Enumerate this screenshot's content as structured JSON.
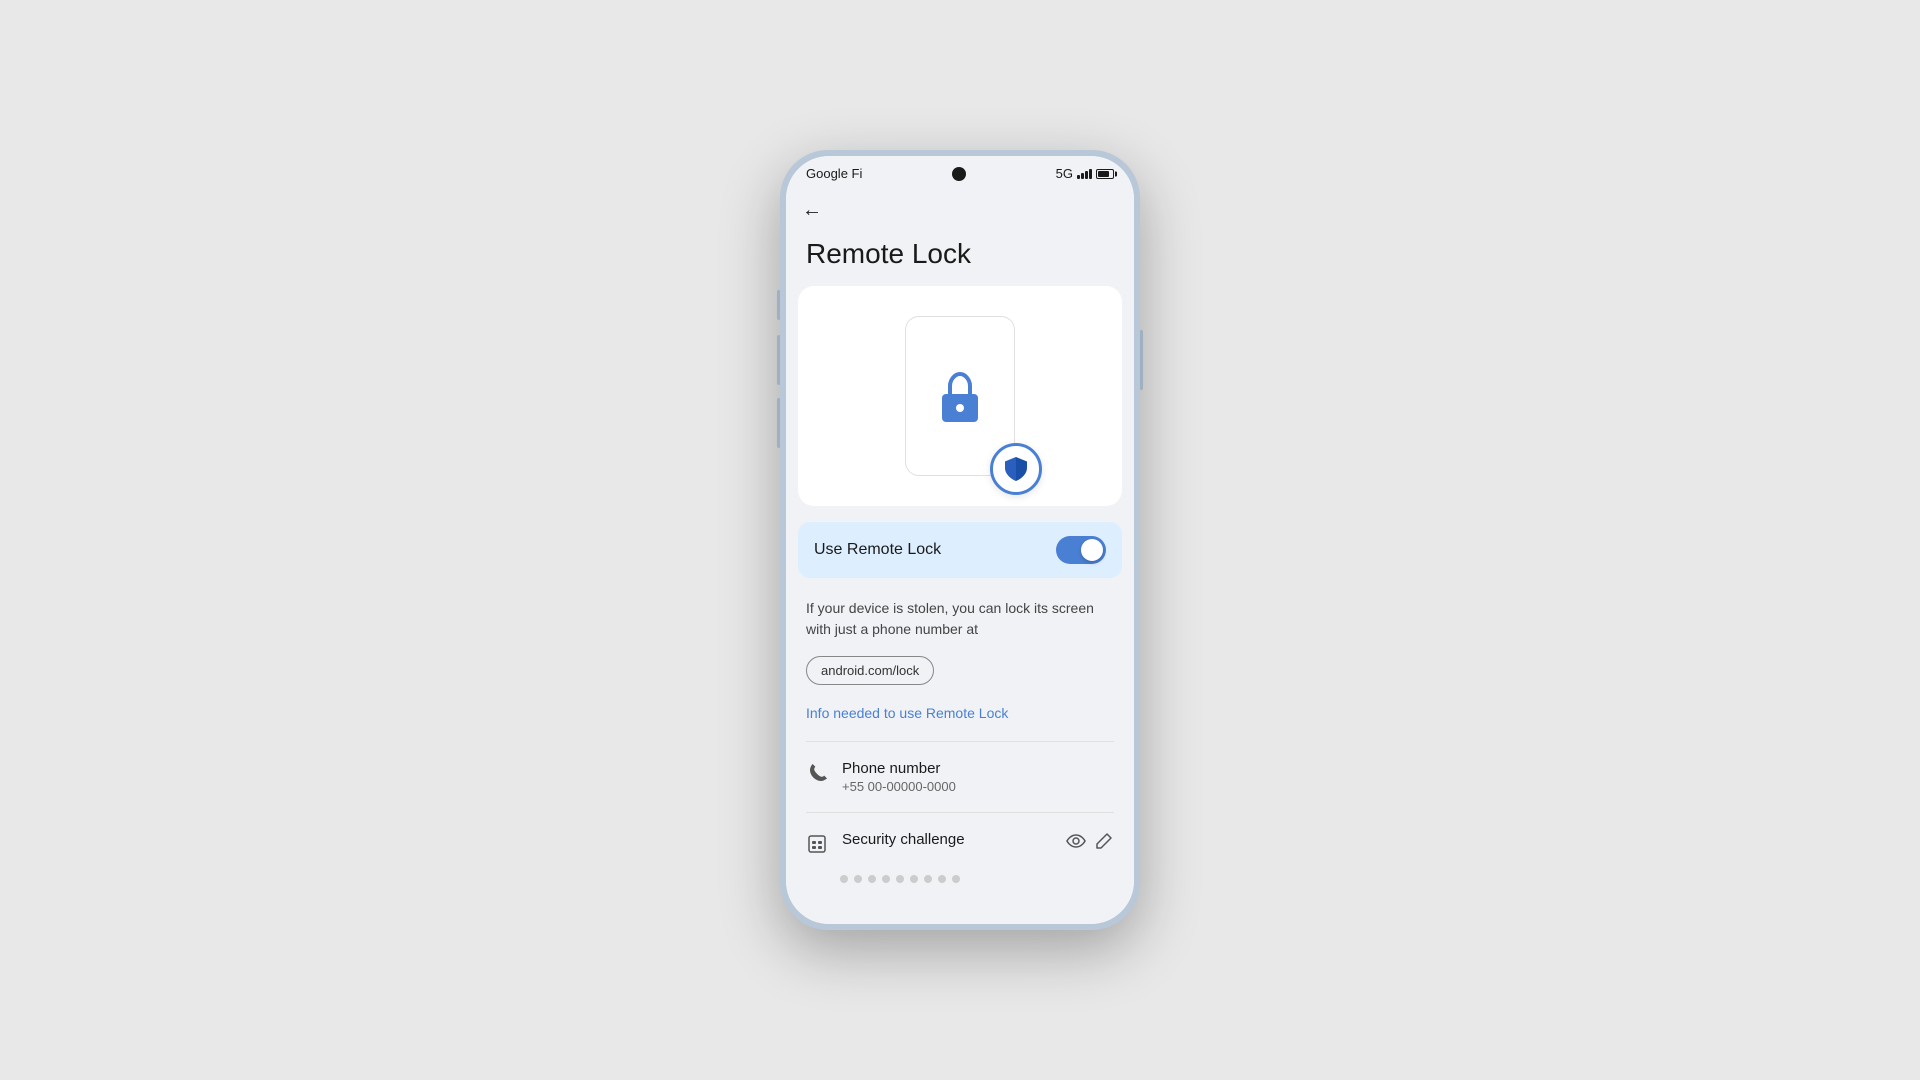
{
  "status_bar": {
    "carrier": "Google Fi",
    "network": "5G",
    "time": ""
  },
  "page": {
    "title": "Remote Lock",
    "back_label": "←"
  },
  "toggle_section": {
    "label": "Use Remote Lock",
    "enabled": true
  },
  "description": {
    "text": "If your device is stolen, you can lock its screen with just a phone number at"
  },
  "link": {
    "label": "android.com/lock"
  },
  "info_link": {
    "label": "Info needed to use Remote Lock"
  },
  "phone_number": {
    "title": "Phone number",
    "value": "+55 00-00000-0000"
  },
  "security_challenge": {
    "title": "Security challenge"
  },
  "icons": {
    "back": "←",
    "phone": "📞",
    "calendar": "📅",
    "eye": "👁",
    "edit": "✏"
  }
}
